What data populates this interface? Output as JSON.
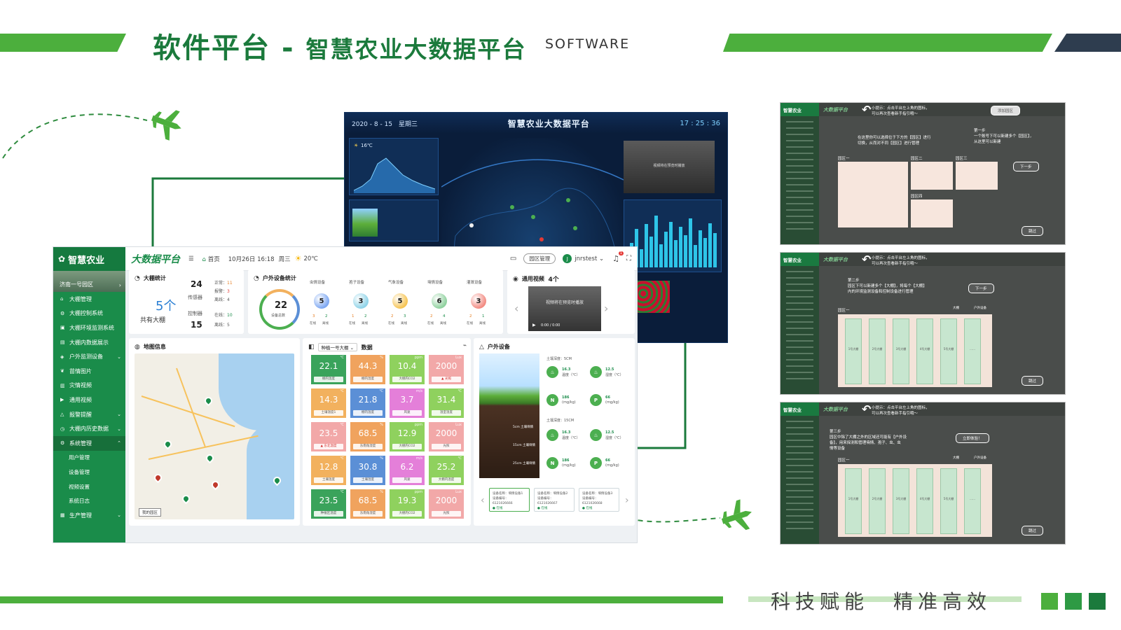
{
  "slide": {
    "title_main": "软件平台",
    "title_dash": "-",
    "title_sub": "智慧农业大数据平台",
    "title_en": "SOFTWARE",
    "slogan": "科技赋能　精准高效",
    "colors": {
      "primary_green": "#4caf3d",
      "dark_green": "#1b7a3c",
      "navy": "#2e3d4f"
    }
  },
  "bigscreen": {
    "date": "2020 - 8 - 15　星期三",
    "title": "智慧农业大数据平台",
    "clock": "17 : 25 : 36",
    "temp": "16℃",
    "video_placeholder": "视频将在预览时播放"
  },
  "platform": {
    "sidebar": {
      "logo": "智慧农业",
      "park": "济南一号园区",
      "items": [
        {
          "label": "大棚管理",
          "icon": "home-icon",
          "type": "item"
        },
        {
          "label": "大棚控制系统",
          "icon": "control-icon",
          "type": "item"
        },
        {
          "label": "大棚环境监测系统",
          "icon": "monitor-icon",
          "type": "item"
        },
        {
          "label": "大棚内数据展示",
          "icon": "data-icon",
          "type": "item"
        },
        {
          "label": "户外监测设备",
          "icon": "device-icon",
          "type": "item",
          "chevron": "⌄"
        },
        {
          "label": "苗情图片",
          "icon": "leaf-icon",
          "type": "item"
        },
        {
          "label": "灾情视频",
          "icon": "chart-icon",
          "type": "item"
        },
        {
          "label": "通用视频",
          "icon": "video-icon",
          "type": "item"
        },
        {
          "label": "报警提醒",
          "icon": "alert-icon",
          "type": "item",
          "chevron": "⌄"
        },
        {
          "label": "大棚内历史数据",
          "icon": "history-icon",
          "type": "item",
          "chevron": "⌄"
        },
        {
          "label": "系统管理",
          "icon": "gear-icon",
          "type": "head",
          "chevron": "⌃"
        },
        {
          "label": "用户管理",
          "type": "sub"
        },
        {
          "label": "设备管理",
          "type": "sub"
        },
        {
          "label": "视频设置",
          "type": "sub"
        },
        {
          "label": "系统日志",
          "type": "sub"
        },
        {
          "label": "生产管理",
          "icon": "grid-icon",
          "type": "item",
          "chevron": "⌄"
        }
      ]
    },
    "topbar": {
      "brand": "大数据平台",
      "home": "首页",
      "date": "10月26日 16:18",
      "weekday": "周三",
      "temp": "20℃",
      "park_button": "园区管理",
      "user": "jnrstest",
      "avatar_letter": "J",
      "notifications": "1"
    },
    "greenhouse_stats": {
      "title": "大棚统计",
      "count": "5个",
      "caption": "共有大棚",
      "sensor": {
        "label": "传感器",
        "total": "24",
        "normal_label": "正常：",
        "normal": "11",
        "alarm_label": "报警：",
        "alarm": "3",
        "offline_label": "离线：",
        "offline": "4"
      },
      "controller": {
        "label": "控制器",
        "total": "15",
        "online_label": "在线：",
        "online": "10",
        "offline_label": "离线：",
        "offline": "5"
      }
    },
    "outdoor_stats": {
      "title": "户外设备统计",
      "total": "22",
      "total_label": "设备总数",
      "online_label": "在线",
      "offline_label": "离线",
      "devices": [
        {
          "name": "虫情设备",
          "value": "5",
          "online": "3",
          "offline": "2",
          "color": "#7ea8f2"
        },
        {
          "name": "孢子设备",
          "value": "3",
          "online": "1",
          "offline": "2",
          "color": "#8fd3e8"
        },
        {
          "name": "气象设备",
          "value": "5",
          "online": "2",
          "offline": "3",
          "color": "#f6c453"
        },
        {
          "name": "墒情设备",
          "value": "6",
          "online": "2",
          "offline": "4",
          "color": "#8fd19e"
        },
        {
          "name": "灌溉设备",
          "value": "3",
          "online": "2",
          "offline": "1",
          "color": "#f28b82"
        }
      ]
    },
    "video": {
      "title": "通用视频",
      "count": "4个",
      "placeholder": "视频将在预览时播放",
      "time": "0:00 / 0:00"
    },
    "map": {
      "title": "地图信息",
      "park_tag": "我的园区"
    },
    "data_panel": {
      "select": "种植一号大棚",
      "title": "数据",
      "tiles": [
        {
          "value": "22.1",
          "unit": "℃",
          "label": "棚内温度",
          "color": "#3aa35b"
        },
        {
          "value": "44.3",
          "unit": "%",
          "label": "棚内湿度",
          "color": "#f0a35e"
        },
        {
          "value": "10.4",
          "unit": "ppm",
          "label": "大棚内CO2",
          "color": "#8fd15e"
        },
        {
          "value": "2000",
          "unit": "Lux",
          "label": "光照",
          "color": "#f2a8a8",
          "warn": true
        },
        {
          "value": "14.3",
          "unit": "℃",
          "label": "土壤温度1",
          "color": "#f2b15e"
        },
        {
          "value": "21.8",
          "unit": "℃",
          "label": "棚内温度",
          "color": "#5b8fd6"
        },
        {
          "value": "3.7",
          "unit": "m/s",
          "label": "风速",
          "color": "#e47fd9"
        },
        {
          "value": "31.4",
          "unit": "℃",
          "label": "温室温度",
          "color": "#8fd15e"
        },
        {
          "value": "23.5",
          "unit": "℃",
          "label": "东北温度",
          "color": "#f2a8a8",
          "warn": true
        },
        {
          "value": "68.5",
          "unit": "%",
          "label": "东南角湿度",
          "color": "#f0a35e"
        },
        {
          "value": "12.9",
          "unit": "ppm",
          "label": "大棚内CO2",
          "color": "#8fd15e"
        },
        {
          "value": "2000",
          "unit": "Lux",
          "label": "光照",
          "color": "#f2a8a8"
        },
        {
          "value": "12.8",
          "unit": "℃",
          "label": "土壤温度",
          "color": "#f2b15e"
        },
        {
          "value": "30.8",
          "unit": "%",
          "label": "土壤湿度",
          "color": "#5b8fd6"
        },
        {
          "value": "6.2",
          "unit": "m/s",
          "label": "风速",
          "color": "#e47fd9"
        },
        {
          "value": "25.2",
          "unit": "℃",
          "label": "大棚内温度",
          "color": "#8fd15e"
        },
        {
          "value": "23.5",
          "unit": "℃",
          "label": "种植区温度",
          "color": "#3aa35b"
        },
        {
          "value": "68.5",
          "unit": "%",
          "label": "东南角湿度",
          "color": "#f0a35e"
        },
        {
          "value": "19.3",
          "unit": "ppm",
          "label": "大棚内CO2",
          "color": "#8fd15e"
        },
        {
          "value": "2000",
          "unit": "Lux",
          "label": "光照",
          "color": "#f2a8a8"
        }
      ]
    },
    "outdoor_devices": {
      "title": "户外设备",
      "depth_5": "土壤深度：5CM",
      "depth_15": "土壤深度：15CM",
      "depth_labels": [
        "5cm 土壤墒情",
        "15cm 土壤墒情",
        "25cm 土壤墒情"
      ],
      "sensors": [
        {
          "key": "temp",
          "value": "16.3",
          "unit": "温度（℃）"
        },
        {
          "key": "hum",
          "value": "12.5",
          "unit": "湿度（℃）"
        },
        {
          "key": "N",
          "value": "186",
          "unit": "(mg/kg)"
        },
        {
          "key": "P",
          "value": "66",
          "unit": "(mg/kg)"
        }
      ],
      "cards": [
        {
          "line1": "设备名称：墒情设备1",
          "line2": "设备编号：6121026666",
          "status": "在线"
        },
        {
          "line1": "设备名称：墒情设备2",
          "line2": "设备编号：6121026667",
          "status": "在线"
        },
        {
          "line1": "设备名称：墒情设备3",
          "line2": "设备编号：6121026668",
          "status": "在线"
        }
      ]
    }
  },
  "guides": [
    {
      "logo": "智慧农业",
      "brand": "大数据平台",
      "tip": [
        "小提示：点击平台左上角的图标，",
        "可以再次查看新手指引哦～"
      ],
      "note": [
        "在这里你可以选择位于下方的【园区】进行",
        "切换，从而对不同【园区】进行管理"
      ],
      "note2": [
        "第一步",
        "一个账号下可以新建多个【园区】，",
        "从这里可以新建"
      ],
      "button_top": "添加园区",
      "button_next": "下一步",
      "button_skip": "跳过",
      "areas": [
        "园区一",
        "园区二",
        "园区三",
        "园区四"
      ]
    },
    {
      "logo": "智慧农业",
      "brand": "大数据平台",
      "tip": [
        "小提示：点击平台左上角的图标，",
        "可以再次查看新手指引哦～"
      ],
      "note": [
        "第二步",
        "园区下可以新建多个【大棚】，将每个【大棚】",
        "内的环境监测设备和控制设备进行管理"
      ],
      "button_next": "下一步",
      "button_skip": "跳过",
      "area": "园区一",
      "legend": [
        "大棚",
        "户外设备"
      ],
      "houses": [
        "1号大棚",
        "2号大棚",
        "3号大棚",
        "4号大棚",
        "5号大棚",
        "……"
      ]
    },
    {
      "logo": "智慧农业",
      "brand": "大数据平台",
      "tip": [
        "小提示：点击平台左上角的图标，",
        "可以再次查看新手指引哦～"
      ],
      "note": [
        "第三步",
        "园区中除了大棚之外的区域还可能有【户外设",
        "备】，用来探测和管理墒情、孢子、虫、虫",
        "情等设备"
      ],
      "button_next": "立即体验！",
      "button_skip": "跳过",
      "area": "园区一",
      "legend": [
        "大棚",
        "户外设备"
      ],
      "houses": [
        "1号大棚",
        "2号大棚",
        "3号大棚",
        "4号大棚",
        "5号大棚",
        "……"
      ]
    }
  ]
}
